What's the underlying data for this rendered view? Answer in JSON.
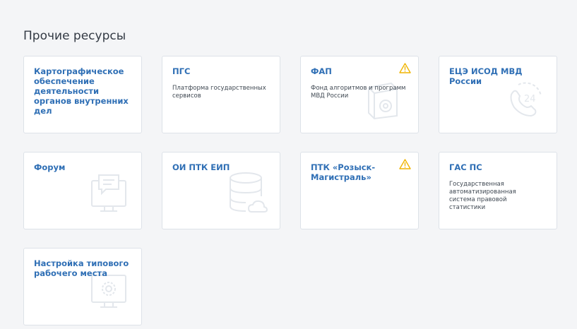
{
  "section": {
    "title": "Прочие ресурсы"
  },
  "cards": [
    {
      "title": "Картографическое обеспечение деятельности органов внутренних дел",
      "desc": "",
      "warning": false,
      "icon": ""
    },
    {
      "title": "ПГС",
      "desc": "Платформа государственных сервисов",
      "warning": false,
      "icon": ""
    },
    {
      "title": "ФАП",
      "desc": "Фонд алгоритмов и программ МВД России",
      "warning": true,
      "icon": "gear-box-icon"
    },
    {
      "title": "ЕЦЭ ИСОД МВД России",
      "desc": "",
      "warning": false,
      "icon": "phone-24-icon",
      "icon_text": "24"
    },
    {
      "title": "Форум",
      "desc": "",
      "warning": false,
      "icon": "monitor-chat-icon"
    },
    {
      "title": "ОИ ПТК ЕИП",
      "desc": "",
      "warning": false,
      "icon": "database-cloud-icon"
    },
    {
      "title": "ПТК «Розыск-Магистраль»",
      "desc": "",
      "warning": true,
      "icon": ""
    },
    {
      "title": "ГАС ПС",
      "desc": "Государственная автоматизированная система правовой статистики",
      "warning": false,
      "icon": ""
    },
    {
      "title": "Настройка типового рабочего места",
      "desc": "",
      "warning": false,
      "icon": "monitor-gear-icon"
    }
  ],
  "colors": {
    "title": "#2f6fb5",
    "warning": "#f0b400",
    "icon": "#e3e7ec",
    "border": "#dde2e8"
  }
}
